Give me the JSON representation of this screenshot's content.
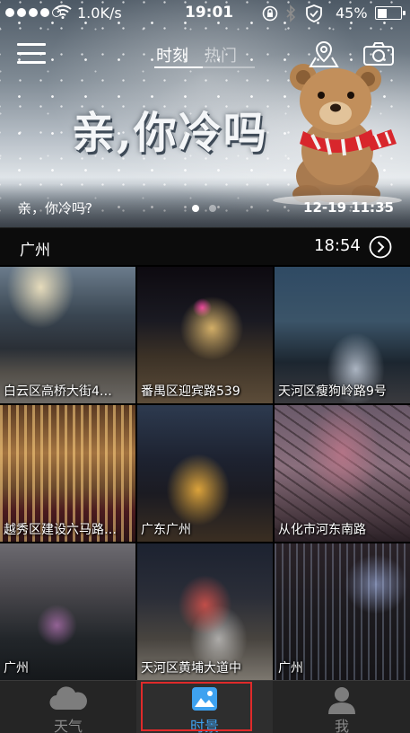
{
  "status_bar": {
    "net_speed": "1.0K/s",
    "clock": "19:01",
    "battery_percent": "45%",
    "battery_level": 0.45
  },
  "header": {
    "tabs": [
      {
        "label": "时刻",
        "active": true
      },
      {
        "label": "热门",
        "active": false
      }
    ]
  },
  "banner": {
    "headline": "亲,你冷吗",
    "caption": "亲，你冷吗?",
    "date": "12-19 11:35",
    "page_count": 2,
    "active_page": 1
  },
  "location_bar": {
    "city": "广州",
    "time": "18:54"
  },
  "photos": [
    {
      "label": "白云区高桥大街4…"
    },
    {
      "label": "番禺区迎宾路539"
    },
    {
      "label": "天河区瘦狗岭路9号"
    },
    {
      "label": "越秀区建设六马路…"
    },
    {
      "label": "广东广州"
    },
    {
      "label": "从化市河东南路"
    },
    {
      "label": "广州"
    },
    {
      "label": "天河区黄埔大道中"
    },
    {
      "label": "广州"
    }
  ],
  "tab_bar": {
    "items": [
      {
        "label": "天气",
        "icon": "cloud-icon",
        "active": false
      },
      {
        "label": "时景",
        "icon": "picture-icon",
        "active": true
      },
      {
        "label": "我",
        "icon": "person-icon",
        "active": false
      }
    ]
  },
  "colors": {
    "accent": "#3ea2f0",
    "highlight_box": "#e02a2a",
    "tab_bar_bg": "#252525"
  }
}
